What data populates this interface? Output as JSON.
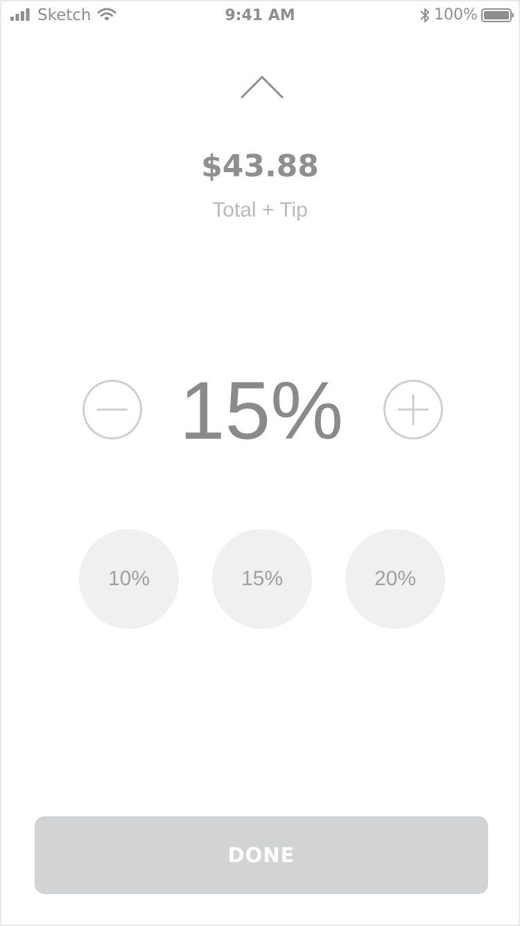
{
  "status_bar": {
    "carrier": "Sketch",
    "time": "9:41 AM",
    "battery": "100%"
  },
  "summary": {
    "total": "$43.88",
    "label": "Total + Tip"
  },
  "tip": {
    "value": "15%",
    "minus_icon": "minus-icon",
    "plus_icon": "plus-icon"
  },
  "presets": [
    "10%",
    "15%",
    "20%"
  ],
  "done_label": "DONE",
  "colors": {
    "text_dark": "#8a8a8a",
    "text_light": "#b9b9b9",
    "preset_bg": "#f0f0f0",
    "button_bg": "#d2d3d5"
  }
}
